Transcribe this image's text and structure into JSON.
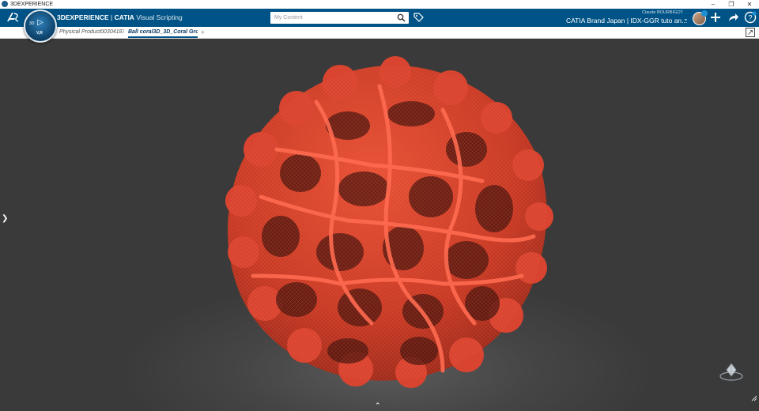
{
  "window": {
    "title": "3DEXPERIENCE",
    "controls": {
      "minimize": "–",
      "restore": "❐",
      "close": "✕"
    }
  },
  "topbar": {
    "brand_part1": "3DEXPERIENCE",
    "brand_sep": " | ",
    "brand_part2": "CATIA",
    "brand_part3": " Visual Scripting",
    "search_placeholder": "My Content",
    "user_name": "Claude BOURBIGOT",
    "tenant": "CATIA Brand Japan | IDX-GGR tuto an...",
    "compass": {
      "label_3d": "3D",
      "label_vr": "V,R"
    }
  },
  "tabs": [
    {
      "label": "Physical Product00304187",
      "active": false
    },
    {
      "label": "Ball coral3D_3D_Coral Gro",
      "active": true
    }
  ],
  "tab_add": "+",
  "icons": {
    "compass": "compass-icon",
    "search": "search-icon",
    "tag": "tag-icon",
    "add": "plus-icon",
    "share": "share-icon",
    "help": "help-icon",
    "expand": "expand-icon",
    "navigation_cube": "nav-cube-icon"
  },
  "colors": {
    "topbar": "#005386",
    "viewport": "#3a3a3a",
    "coral_light": "#ff6a4f",
    "coral_mid": "#d8402c",
    "coral_dark": "#5a1a12"
  }
}
